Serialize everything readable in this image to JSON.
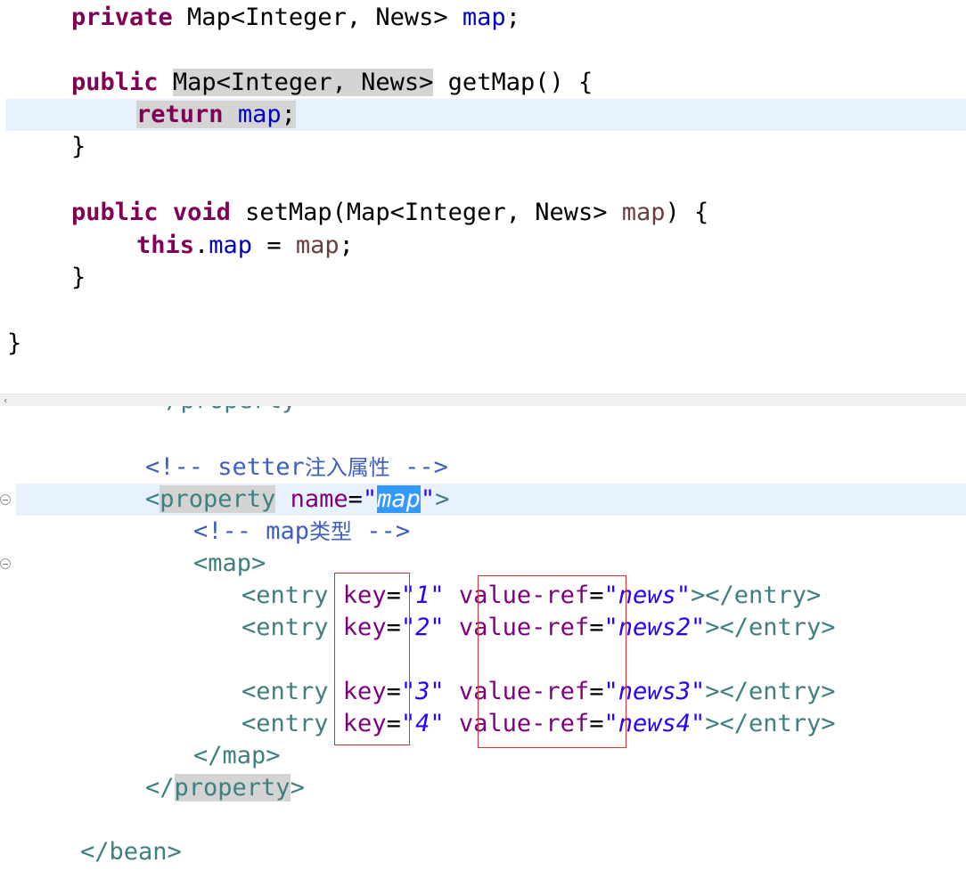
{
  "java": {
    "line1": {
      "kw": "private",
      "type": " Map<Integer, News> ",
      "field": "map",
      "end": ";"
    },
    "line2": {
      "kw": "public",
      "sp": " ",
      "type": "Map<Integer, News>",
      "rest": " getMap() {"
    },
    "line3": {
      "kw": "return",
      "sp": " ",
      "field": "map",
      "end": ";"
    },
    "line4": {
      "brace": "}"
    },
    "line5": {
      "kw1": "public",
      "sp1": " ",
      "kw2": "void",
      "rest1": " setMap(Map<Integer, News> ",
      "param": "map",
      "rest2": ") {"
    },
    "line6": {
      "kw": "this",
      "dot": ".",
      "field": "map",
      "eq": " = ",
      "param": "map",
      "end": ";"
    },
    "line7": {
      "brace": "}"
    },
    "line8": {
      "brace": "}"
    }
  },
  "xml": {
    "partial_top": "</property>",
    "comment1": {
      "open": "<!-- setter",
      "cjk": "注入属性",
      "close": " -->"
    },
    "property_open": {
      "lt": "<",
      "tag": "property",
      "attr": " name",
      "eq": "=",
      "q1": "\"",
      "val": "map",
      "q2": "\"",
      "gt": ">"
    },
    "comment2": {
      "open": "<!-- map",
      "cjk": "类型",
      "close": " -->"
    },
    "map_open": "<map>",
    "entries": [
      {
        "tag": "<entry",
        "key_attr": " key",
        "eq1": "=",
        "key": "\"1\"",
        "ref_attr": " value-ref",
        "eq2": "=",
        "ref": "\"news\"",
        "close": "></entry>"
      },
      {
        "tag": "<entry",
        "key_attr": " key",
        "eq1": "=",
        "key": "\"2\"",
        "ref_attr": " value-ref",
        "eq2": "=",
        "ref": "\"news2\"",
        "close": "></entry>"
      },
      {
        "tag": "<entry",
        "key_attr": " key",
        "eq1": "=",
        "key": "\"3\"",
        "ref_attr": " value-ref",
        "eq2": "=",
        "ref": "\"news3\"",
        "close": "></entry>"
      },
      {
        "tag": "<entry",
        "key_attr": " key",
        "eq1": "=",
        "key": "\"4\"",
        "ref_attr": " value-ref",
        "eq2": "=",
        "ref": "\"news4\"",
        "close": "></entry>"
      }
    ],
    "map_close": "</map>",
    "property_close": {
      "lt": "</",
      "tag": "property",
      "gt": ">"
    },
    "bean_close": "</bean>"
  },
  "scroll_arrow": "‹"
}
